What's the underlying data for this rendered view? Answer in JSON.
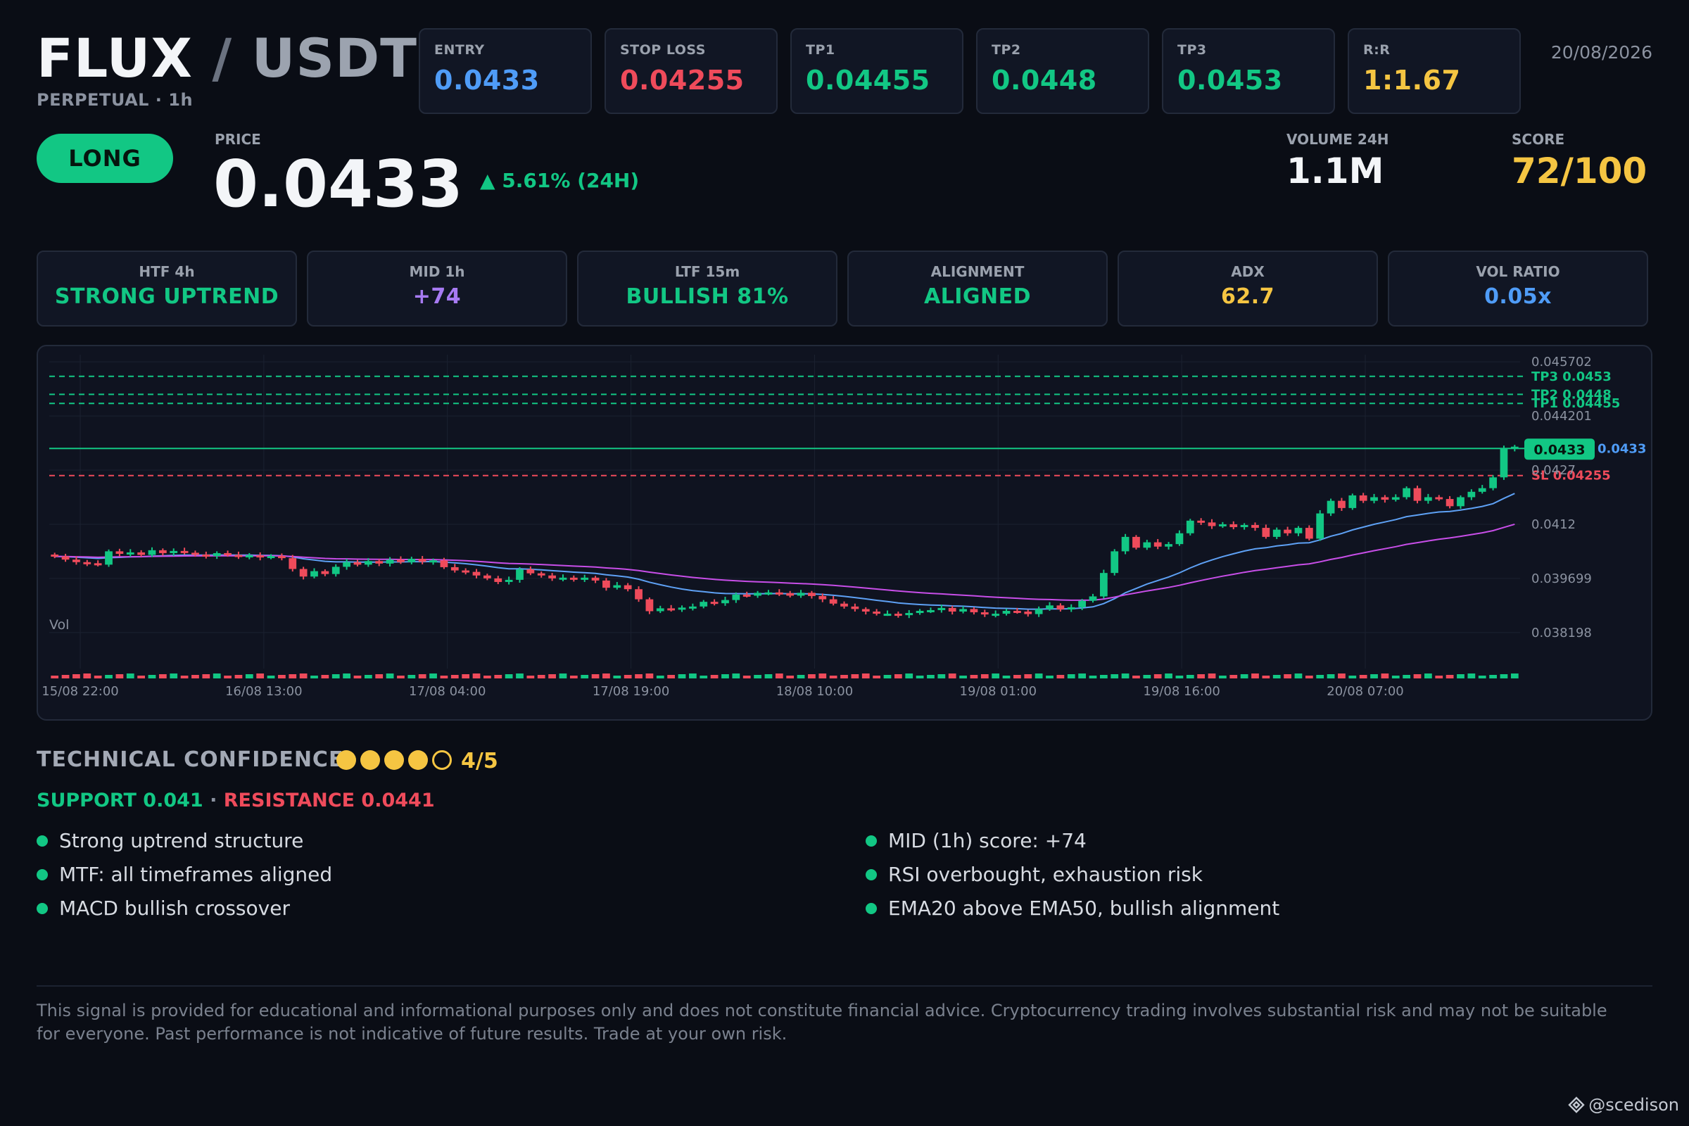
{
  "header": {
    "pair_base": "FLUX",
    "pair_sep": " / ",
    "pair_quote": "USDT",
    "subtitle": "PERPETUAL · 1h",
    "date": "20/08/2026"
  },
  "levels": [
    {
      "label": "ENTRY",
      "value": "0.0433",
      "color": "#4f9cf7"
    },
    {
      "label": "STOP LOSS",
      "value": "0.04255",
      "color": "#ef4b5b"
    },
    {
      "label": "TP1",
      "value": "0.04455",
      "color": "#12c784"
    },
    {
      "label": "TP2",
      "value": "0.0448",
      "color": "#12c784"
    },
    {
      "label": "TP3",
      "value": "0.0453",
      "color": "#12c784"
    },
    {
      "label": "R:R",
      "value": "1:1.67",
      "color": "#f5c542"
    }
  ],
  "signal": {
    "direction": "LONG",
    "price_label": "PRICE",
    "price": "0.0433",
    "change": "▲ 5.61% (24H)",
    "volume_label": "VOLUME 24H",
    "volume": "1.1M",
    "score_label": "SCORE",
    "score": "72/100"
  },
  "indicators": [
    {
      "label": "HTF 4h",
      "value": "STRONG UPTREND",
      "color": "#12c784"
    },
    {
      "label": "MID 1h",
      "value": "+74",
      "color": "#a77bf3"
    },
    {
      "label": "LTF 15m",
      "value": "BULLISH 81%",
      "color": "#12c784"
    },
    {
      "label": "ALIGNMENT",
      "value": "ALIGNED",
      "color": "#12c784"
    },
    {
      "label": "ADX",
      "value": "62.7",
      "color": "#f5c542"
    },
    {
      "label": "VOL RATIO",
      "value": "0.05x",
      "color": "#4f9cf7"
    }
  ],
  "chart_data": {
    "type": "candlestick",
    "x_ticks": [
      "15/08 22:00",
      "16/08 13:00",
      "17/08 04:00",
      "17/08 19:00",
      "18/08 10:00",
      "19/08 01:00",
      "19/08 16:00",
      "20/08 07:00"
    ],
    "y_ticks": [
      "0.045702",
      "0.044201",
      "0.0427",
      "0.0412",
      "0.039699",
      "0.038198"
    ],
    "ylim": [
      0.0372,
      0.0459
    ],
    "volume_label": "Vol",
    "closes": [
      0.04031,
      0.04022,
      0.04015,
      0.04012,
      0.04008,
      0.04045,
      0.04038,
      0.04042,
      0.04035,
      0.04048,
      0.0404,
      0.04046,
      0.04041,
      0.04036,
      0.04032,
      0.0404,
      0.04035,
      0.0403,
      0.04034,
      0.04028,
      0.04032,
      0.04026,
      0.03996,
      0.03975,
      0.0399,
      0.03982,
      0.04002,
      0.04015,
      0.04008,
      0.04018,
      0.04011,
      0.04022,
      0.04015,
      0.04024,
      0.04016,
      0.0402,
      0.04001,
      0.03992,
      0.03988,
      0.03978,
      0.0397,
      0.0396,
      0.03966,
      0.03995,
      0.03984,
      0.03978,
      0.0397,
      0.03972,
      0.03966,
      0.03972,
      0.03964,
      0.03944,
      0.03951,
      0.0394,
      0.03912,
      0.03879,
      0.03887,
      0.03884,
      0.03889,
      0.03892,
      0.03905,
      0.03901,
      0.0391,
      0.03925,
      0.03922,
      0.0393,
      0.03931,
      0.03929,
      0.03922,
      0.0393,
      0.03921,
      0.03912,
      0.039,
      0.03892,
      0.03885,
      0.03878,
      0.03872,
      0.03872,
      0.03868,
      0.03874,
      0.0388,
      0.03882,
      0.03888,
      0.03878,
      0.03885,
      0.03876,
      0.0387,
      0.03872,
      0.0388,
      0.03878,
      0.03871,
      0.03885,
      0.03895,
      0.03884,
      0.0389,
      0.03908,
      0.0392,
      0.03985,
      0.04045,
      0.04085,
      0.04055,
      0.0407,
      0.04058,
      0.04065,
      0.04095,
      0.0413,
      0.04125,
      0.04115,
      0.0412,
      0.04112,
      0.04118,
      0.0411,
      0.04085,
      0.04105,
      0.04095,
      0.0411,
      0.0408,
      0.0415,
      0.04185,
      0.04165,
      0.042,
      0.04185,
      0.04195,
      0.04188,
      0.04195,
      0.0422,
      0.04185,
      0.04195,
      0.0419,
      0.0417,
      0.04195,
      0.0421,
      0.0422,
      0.0425,
      0.0433,
      0.04335
    ],
    "levels": [
      {
        "label": "TP3 0.0453",
        "value": 0.0453,
        "color": "#12c784"
      },
      {
        "label": "TP2 0.0448",
        "value": 0.0448,
        "color": "#12c784"
      },
      {
        "label": "TP1 0.04455",
        "value": 0.04455,
        "color": "#12c784"
      },
      {
        "label": "SL 0.04255",
        "value": 0.04255,
        "color": "#ef4b5b"
      }
    ],
    "entry": {
      "value": 0.0433,
      "label": "0.0433"
    },
    "current_price_tag": "0.0433",
    "colors": {
      "up": "#12c784",
      "down": "#ef4b5b",
      "ema20": "#5ea1f5",
      "ema50": "#c84ee8",
      "grid": "#1b2130",
      "axis_text": "#8b92a0"
    }
  },
  "confidence": {
    "title": "TECHNICAL CONFIDENCE",
    "filled": 4,
    "total": 5,
    "score": "4/5",
    "support": "SUPPORT 0.041",
    "separator": " · ",
    "resistance": "RESISTANCE 0.0441"
  },
  "reasons_left": [
    "Strong uptrend structure",
    "MTF: all timeframes aligned",
    "MACD bullish crossover"
  ],
  "reasons_right": [
    "MID (1h) score: +74",
    "RSI overbought, exhaustion risk",
    "EMA20 above EMA50, bullish alignment"
  ],
  "disclaimer": "This signal is provided for educational and informational purposes only and does not constitute financial advice. Cryptocurrency trading involves substantial risk and may not be suitable for everyone. Past performance is not indicative of future results. Trade at your own risk.",
  "watermark": "@scedison"
}
